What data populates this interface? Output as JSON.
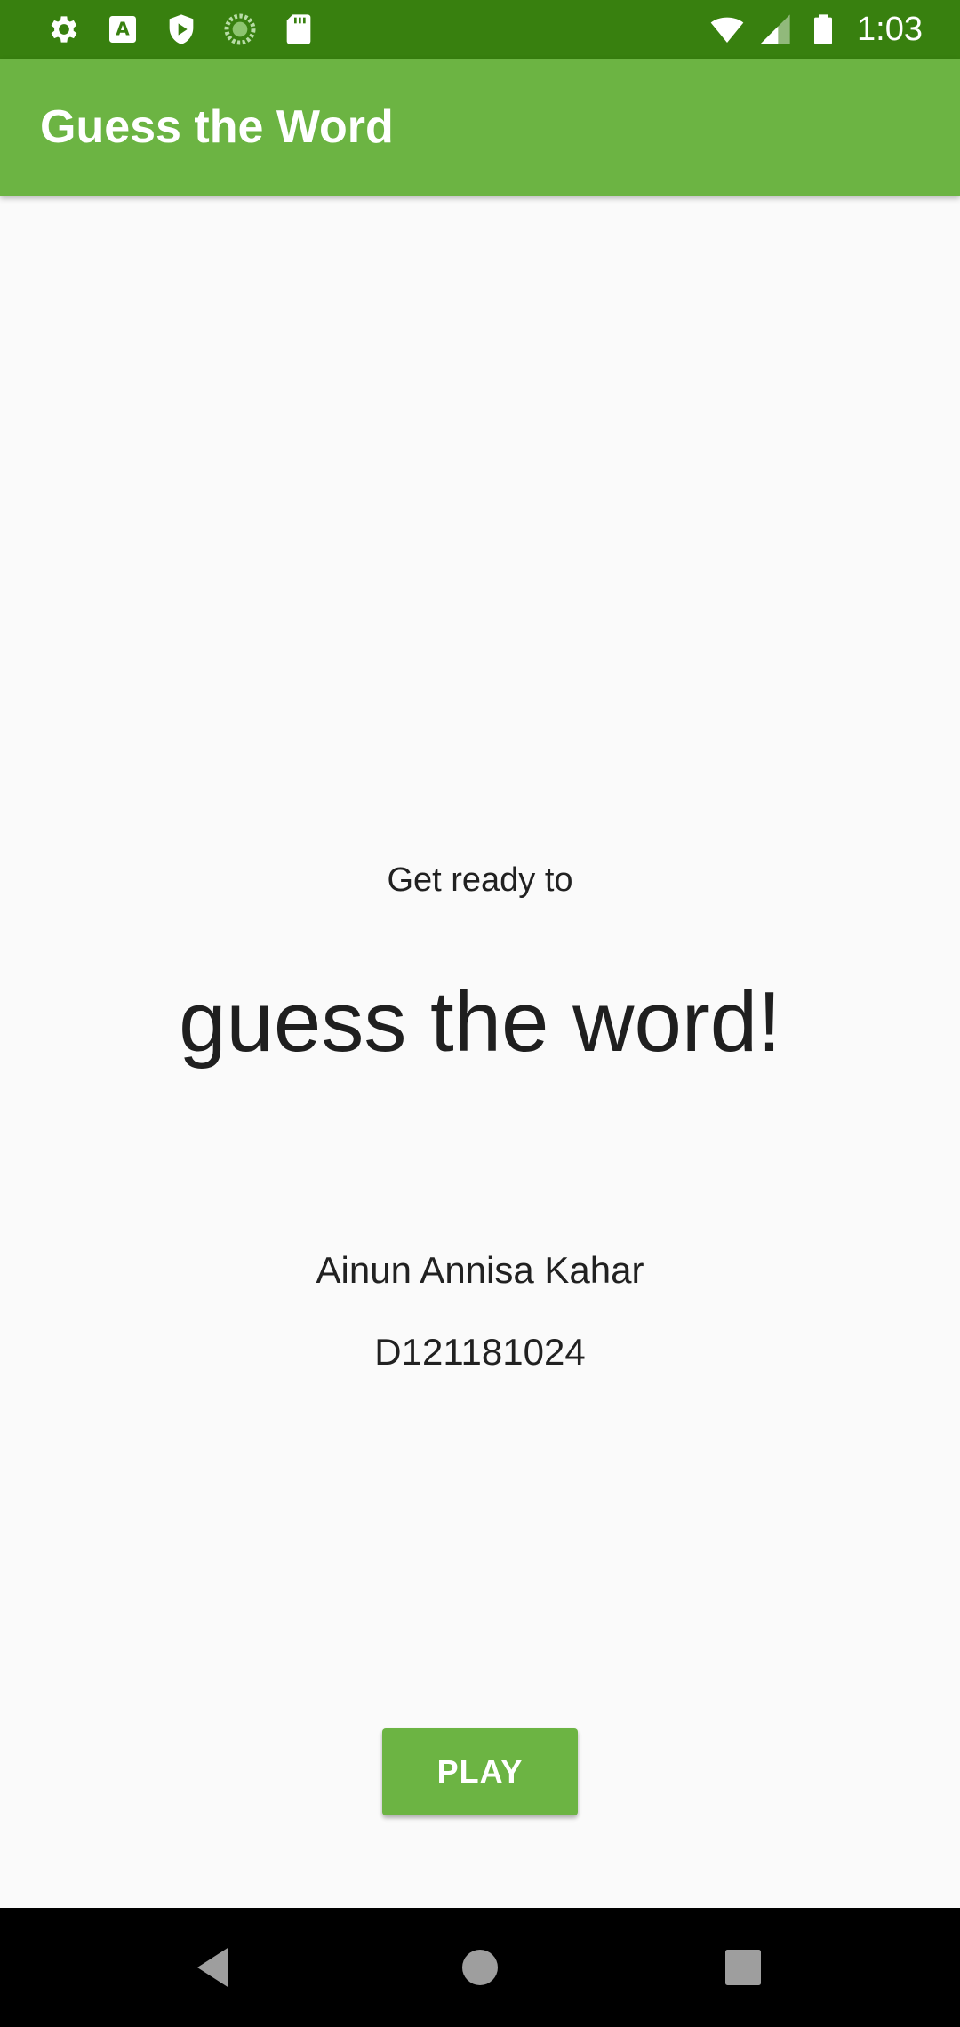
{
  "status_bar": {
    "left_icons": [
      "settings-gear-icon",
      "text-a-icon",
      "shield-play-icon",
      "sync-circle-icon",
      "sd-card-icon"
    ],
    "right_icons": [
      "wifi-icon",
      "cell-signal-icon",
      "battery-icon"
    ],
    "time": "1:03",
    "background_color": "#38800f"
  },
  "app_bar": {
    "title": "Guess the Word",
    "background_color": "#6cb443"
  },
  "main": {
    "intro": "Get ready to",
    "headline": "guess the word!",
    "author_name": "Ainun Annisa Kahar",
    "author_id": "D121181024",
    "play_label": "PLAY",
    "accent_color": "#6cb443"
  },
  "nav_bar": {
    "buttons": [
      "back-triangle-icon",
      "home-circle-icon",
      "recents-square-icon"
    ]
  }
}
